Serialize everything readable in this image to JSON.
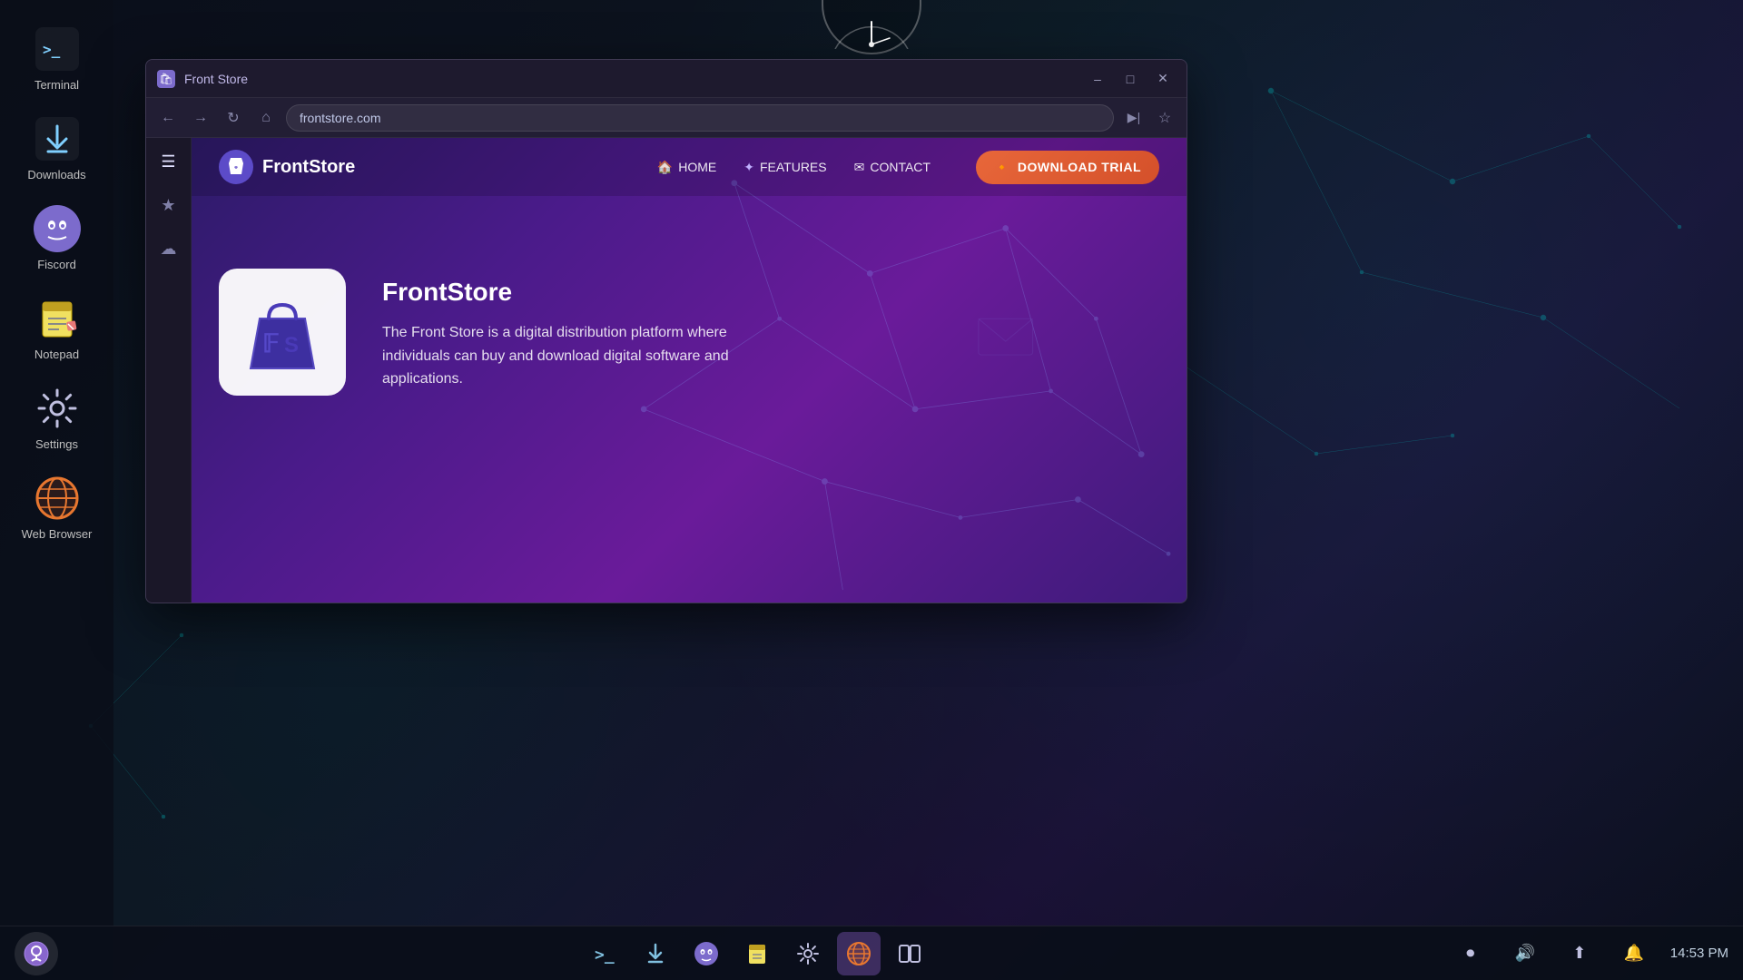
{
  "desktop": {
    "background_color": "#0d1117"
  },
  "left_sidebar": {
    "apps": [
      {
        "id": "terminal",
        "label": "Terminal",
        "icon": ">_"
      },
      {
        "id": "downloads",
        "label": "Downloads",
        "icon": "⬇"
      },
      {
        "id": "fiscord",
        "label": "Fiscord",
        "icon": "👾"
      },
      {
        "id": "notepad",
        "label": "Notepad",
        "icon": "📝"
      },
      {
        "id": "settings",
        "label": "Settings",
        "icon": "⚙"
      },
      {
        "id": "web-browser",
        "label": "Web Browser",
        "icon": "🌐"
      }
    ]
  },
  "taskbar": {
    "time": "14:53 PM",
    "apps": [
      {
        "id": "podcast",
        "icon": "🎙"
      },
      {
        "id": "terminal",
        "icon": ">_"
      },
      {
        "id": "downloads",
        "icon": "⬇"
      },
      {
        "id": "fiscord",
        "icon": "👾"
      },
      {
        "id": "notepad",
        "icon": "📝"
      },
      {
        "id": "settings",
        "icon": "⚙"
      },
      {
        "id": "browser",
        "icon": "🌐",
        "active": true
      },
      {
        "id": "panels",
        "icon": "▐▌"
      }
    ],
    "system_icons": [
      {
        "id": "record",
        "icon": "⏺"
      },
      {
        "id": "volume",
        "icon": "🔊"
      },
      {
        "id": "share",
        "icon": "📤"
      },
      {
        "id": "bell",
        "icon": "🔔"
      }
    ]
  },
  "browser": {
    "title": "Front Store",
    "url": "frontstore.com",
    "sidebar_icons": [
      "≡",
      "★",
      "☁"
    ]
  },
  "website": {
    "brand": "FrontStore",
    "logo_symbol": "🛍",
    "nav_links": [
      {
        "id": "home",
        "label": "HOME",
        "icon": "🏠"
      },
      {
        "id": "features",
        "label": "FEATURES",
        "icon": "✦"
      },
      {
        "id": "contact",
        "label": "CONTACT",
        "icon": "✉"
      }
    ],
    "cta_button": "DOWNLOAD TRIAL",
    "cta_icon": "🔸",
    "hero": {
      "title": "FrontStore",
      "description": "The Front Store is a digital distribution platform where individuals can buy and download digital software and applications."
    }
  }
}
